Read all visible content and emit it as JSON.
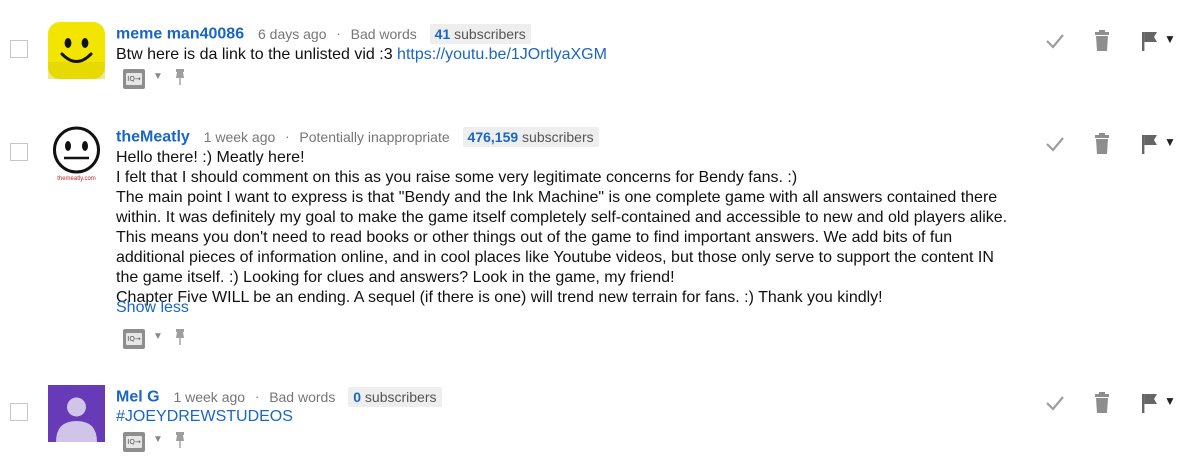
{
  "comments": [
    {
      "author": "meme man40086",
      "time": "6 days ago",
      "category": "Bad words",
      "subscribers_count": "41",
      "subscribers_label": "subscribers",
      "text": "Btw here is da link to the unlisted vid :3 ",
      "link": "https://youtu.be/1JOrtlyaXGM",
      "avatar": "yellow-smiley-avatar"
    },
    {
      "author": "theMeatly",
      "time": "1 week ago",
      "category": "Potentially inappropriate",
      "subscribers_count": "476,159",
      "subscribers_label": "subscribers",
      "lines": [
        "Hello there! :) Meatly here!",
        "I felt that I should comment on this as you raise some very legitimate concerns for Bendy fans. :)",
        "The main point I want to express is that \"Bendy and the Ink Machine\" is one complete game with all answers contained there within. It was definitely my goal to make the game itself completely self-contained and accessible to new and old players alike. This means you don't need to read books or other things out of the game to find important answers. We add bits of fun additional pieces of information online, and in cool places like Youtube videos, but those only serve to support the content IN the game itself. :) Looking for clues and answers? Look in the game, my friend!",
        "Chapter Five WILL be an ending. A sequel (if there is one) will trend new terrain for fans. :) Thank you kindly!"
      ],
      "show_less": "Show less",
      "avatar": "themeatly-face-avatar",
      "avatar_caption": "themeatly.com"
    },
    {
      "author": "Mel G",
      "time": "1 week ago",
      "category": "Bad words",
      "subscribers_count": "0",
      "subscribers_label": "subscribers",
      "text": "#JOEYDREWSTUDEOS",
      "avatar": "default-person-avatar"
    }
  ],
  "icons": {
    "reply": "reply-icon",
    "dropdown": "chevron-down-icon",
    "pin": "pin-icon",
    "approve": "check-icon",
    "remove": "trash-icon",
    "flag": "flag-icon"
  },
  "colors": {
    "link": "#1a66c4",
    "muted": "#767676",
    "badge_bg": "#eeeeee",
    "icon_gray": "#8e8e8e",
    "avatar_purple": "#673ab7",
    "avatar_yellow": "#f2e500"
  }
}
